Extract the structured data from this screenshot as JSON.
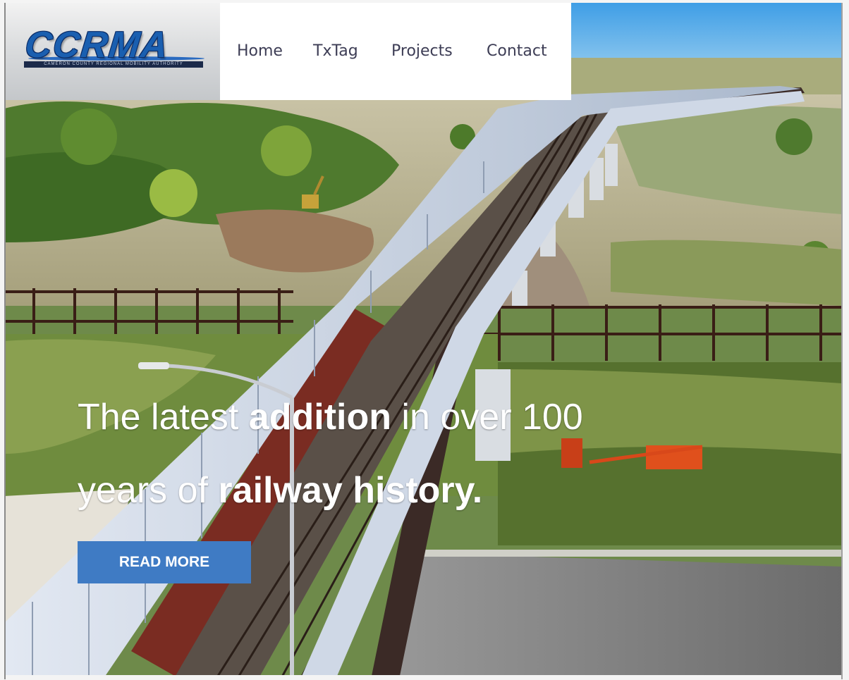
{
  "logo": {
    "text": "CCRMA",
    "subtitle": "CAMERON COUNTY REGIONAL MOBILITY AUTHORITY"
  },
  "nav": {
    "items": [
      {
        "label": "Home"
      },
      {
        "label": "TxTag"
      },
      {
        "label": "Projects"
      },
      {
        "label": "Contact"
      }
    ]
  },
  "hero": {
    "line1_pre": "The latest ",
    "line1_bold": "addition",
    "line1_post": " in over 100",
    "line2_pre": "years of ",
    "line2_bold": "railway history.",
    "button_label": "READ MORE"
  },
  "colors": {
    "brand_blue": "#1a5fb0",
    "button_blue": "#3f7bc4",
    "nav_text": "#3d3d55"
  }
}
